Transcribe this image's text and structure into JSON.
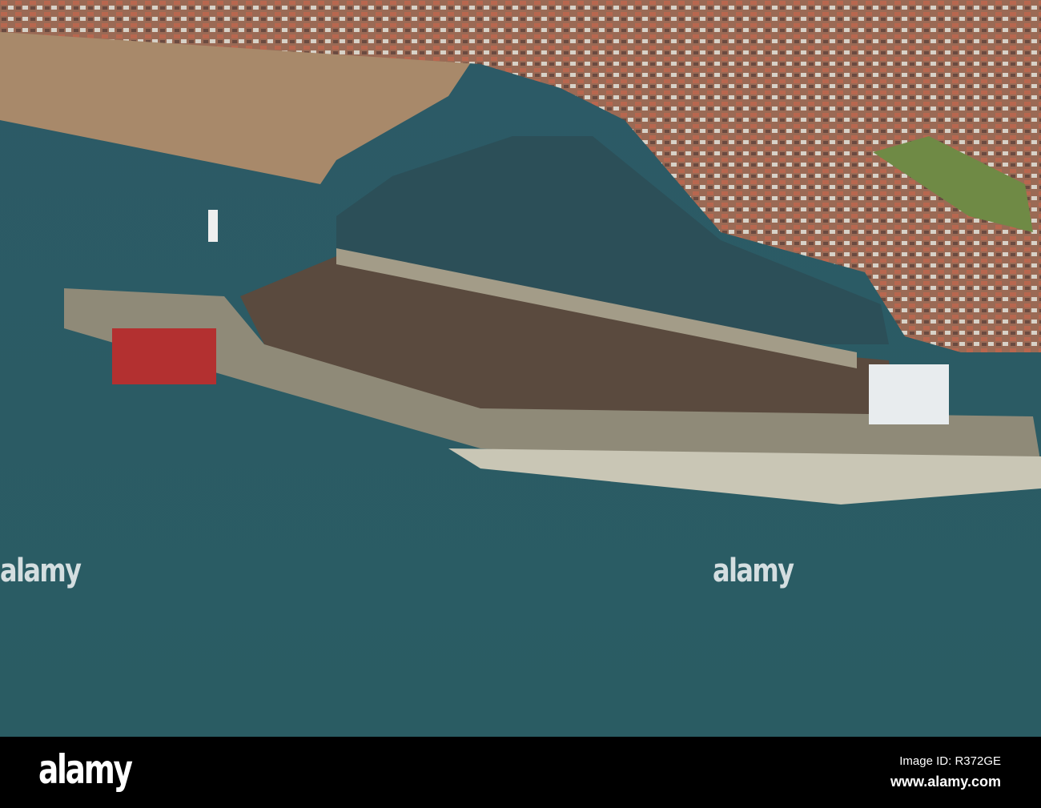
{
  "watermark": {
    "text": "alamy"
  },
  "footer": {
    "logo": "alamy",
    "image_id": "Image ID: R372GE",
    "url": "www.alamy.com"
  },
  "colors": {
    "sea": "#2e5d66",
    "beach": "#a8896a",
    "town": "#8a5a48",
    "bar": "#000000"
  }
}
